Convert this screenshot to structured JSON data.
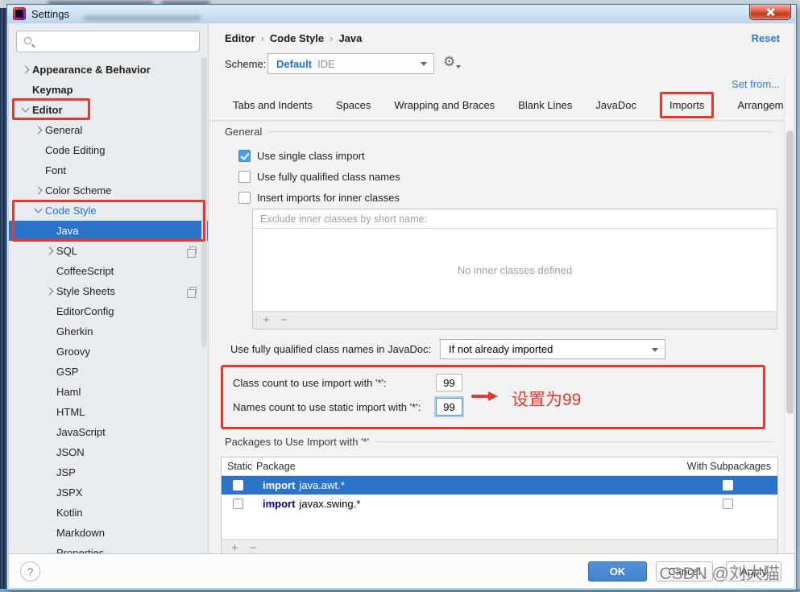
{
  "window": {
    "title": "Settings"
  },
  "sidebar": {
    "search_placeholder": "",
    "items": [
      {
        "label": "Appearance & Behavior"
      },
      {
        "label": "Keymap"
      },
      {
        "label": "Editor"
      },
      {
        "label": "General"
      },
      {
        "label": "Code Editing"
      },
      {
        "label": "Font"
      },
      {
        "label": "Color Scheme"
      },
      {
        "label": "Code Style"
      },
      {
        "label": "Java"
      },
      {
        "label": "SQL"
      },
      {
        "label": "CoffeeScript"
      },
      {
        "label": "Style Sheets"
      },
      {
        "label": "EditorConfig"
      },
      {
        "label": "Gherkin"
      },
      {
        "label": "Groovy"
      },
      {
        "label": "GSP"
      },
      {
        "label": "Haml"
      },
      {
        "label": "HTML"
      },
      {
        "label": "JavaScript"
      },
      {
        "label": "JSON"
      },
      {
        "label": "JSP"
      },
      {
        "label": "JSPX"
      },
      {
        "label": "Kotlin"
      },
      {
        "label": "Markdown"
      },
      {
        "label": "Properties"
      }
    ]
  },
  "header": {
    "breadcrumb": {
      "0": "Editor",
      "1": "Code Style",
      "2": "Java",
      "sep": "›"
    },
    "reset": "Reset",
    "scheme_label": "Scheme:",
    "scheme_value": "Default",
    "scheme_suffix": "IDE",
    "set_from": "Set from...",
    "gear": "⚙"
  },
  "tabs": {
    "0": "Tabs and Indents",
    "1": "Spaces",
    "2": "Wrapping and Braces",
    "3": "Blank Lines",
    "4": "JavaDoc",
    "5": "Imports",
    "6": "Arrangement"
  },
  "general": {
    "section": "General",
    "cb_single": "Use single class import",
    "cb_fqn": "Use fully qualified class names",
    "cb_inner": "Insert imports for inner classes",
    "exclude_header": "Exclude inner classes by short name:",
    "exclude_empty": "No inner classes defined"
  },
  "javadoc": {
    "label": "Use fully qualified class names in JavaDoc:",
    "value": "If not already imported"
  },
  "counts": {
    "class_label": "Class count to use import with '*':",
    "class_value": "99",
    "names_label": "Names count to use static import with '*':",
    "names_value": "99",
    "annotation": "设置为99"
  },
  "packages": {
    "section": "Packages to Use Import with '*'",
    "headers": {
      "static": "Static",
      "package": "Package",
      "subpackages": "With Subpackages"
    },
    "rows": [
      {
        "keyword": "import",
        "package": "java.awt.*"
      },
      {
        "keyword": "import",
        "package": "javax.swing.*"
      }
    ]
  },
  "icons": {
    "plus": "+",
    "minus": "−",
    "help": "?"
  },
  "footer": {
    "ok": "OK",
    "cancel": "Cancel",
    "apply": "Apply",
    "watermark": "CSDN @刘大猫"
  },
  "colors": {
    "selection_blue": "#2b73c8",
    "annotation_red": "#e23b2e",
    "link_blue": "#2f7bd1",
    "ok_blue": "#4381cd"
  }
}
